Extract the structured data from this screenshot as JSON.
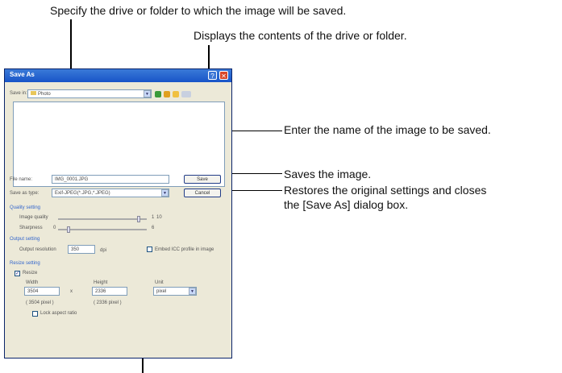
{
  "annotations": {
    "save_in": "Specify the drive or folder to which the image will be saved.",
    "contents": "Displays the contents of the drive or folder.",
    "file_name": "Enter the name of the image to be saved.",
    "save_button": "Saves the image.",
    "cancel_button_line1": "Restores the original settings and closes",
    "cancel_button_line2": "the [Save As] dialog box."
  },
  "dialog": {
    "title": "Save As",
    "help_glyph": "?",
    "close_glyph": "✕",
    "save_in_label": "Save in:",
    "save_in_value": "Photo",
    "file_name_label": "File name:",
    "file_name_value": "IMG_0001.JPG",
    "file_type_label": "Save as type:",
    "file_type_value": "Exif-JPEG(*.JPG,*.JPEG)",
    "save_button": "Save",
    "cancel_button": "Cancel",
    "quality": {
      "header": "Quality setting",
      "image_quality_label": "Image quality",
      "image_quality_min": "1",
      "image_quality_max": "10",
      "sharpness_label": "Sharpness",
      "sharpness_min": "0",
      "sharpness_max": "6",
      "image_quality_level": 0.92,
      "sharpness_level": 0.1
    },
    "output": {
      "header": "Output setting",
      "resolution_label": "Output resolution",
      "resolution_value": "350",
      "resolution_unit": "dpi",
      "embed_icc_label": "Embed ICC profile in image"
    },
    "resize": {
      "header": "Resize setting",
      "resize_label": "Resize",
      "width_label": "Width",
      "width_value": "3504",
      "times": "x",
      "height_label": "Height",
      "height_value": "2336",
      "unit_label": "Unit",
      "unit_value": "pixel",
      "width_original": "( 3504 pixel )",
      "height_original": "( 2336 pixel )",
      "lock_label": "Lock aspect ratio"
    },
    "toolbar_icons": [
      "back-icon",
      "up-folder-icon",
      "new-folder-icon",
      "view-menu-icon"
    ]
  },
  "colors": {
    "titlebar": "#2060d0",
    "dialog_bg": "#ece9d8",
    "group_header": "#3366cc"
  }
}
